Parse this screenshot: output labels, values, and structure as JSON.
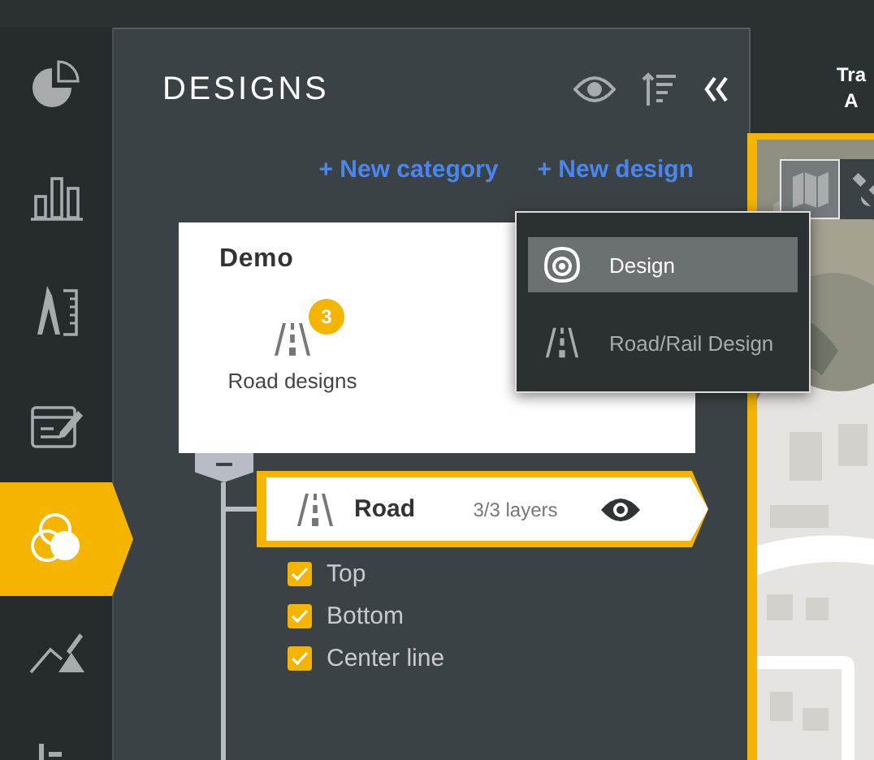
{
  "sidebar": {
    "items": [
      {
        "kind": "pie",
        "selected": false
      },
      {
        "kind": "bars",
        "selected": false
      },
      {
        "kind": "drafting",
        "selected": false
      },
      {
        "kind": "form",
        "selected": false
      },
      {
        "kind": "designs",
        "selected": true
      },
      {
        "kind": "terrain",
        "selected": false
      },
      {
        "kind": "tree",
        "selected": false
      }
    ]
  },
  "panel": {
    "title": "DESIGNS",
    "links": [
      "+ New category",
      "+ New design"
    ],
    "category": {
      "name": "Demo",
      "expanded": true,
      "tile": {
        "label": "Road designs",
        "badge": "3"
      }
    },
    "design": {
      "name": "Road",
      "layers": "3/3 layers",
      "visible": true,
      "layer_list": [
        {
          "label": "Top",
          "checked": true
        },
        {
          "label": "Bottom",
          "checked": true
        },
        {
          "label": "Center line",
          "checked": true
        }
      ]
    }
  },
  "menu": {
    "items": [
      {
        "label": "Design",
        "kind": "design",
        "selected": true
      },
      {
        "label": "Road/Rail Design",
        "kind": "road",
        "selected": false
      }
    ]
  },
  "header": {
    "texts": [
      "Tra",
      "A"
    ]
  },
  "map": {
    "kind": "picture",
    "buttons": [
      {
        "kind": "map",
        "selected": true
      },
      {
        "kind": "satellite",
        "selected": false
      }
    ]
  }
}
